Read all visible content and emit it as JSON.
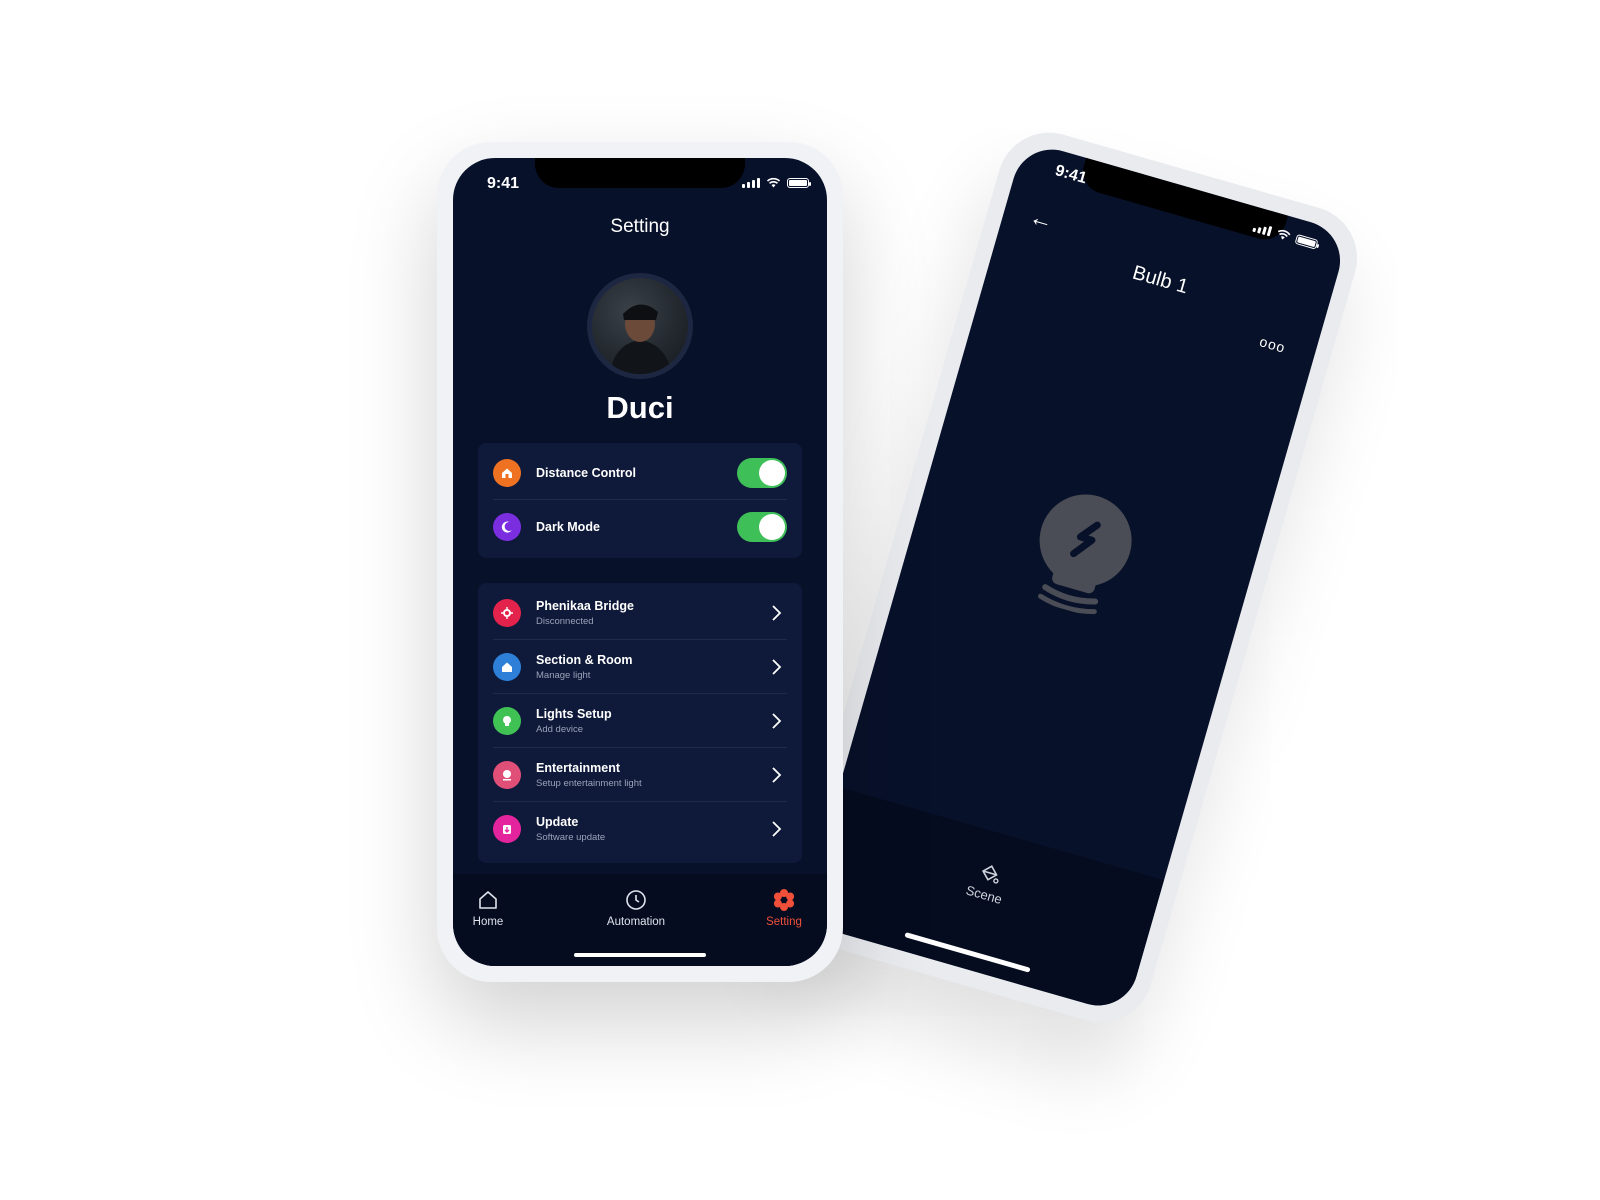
{
  "back_phone": {
    "time": "9:41",
    "title": "Bulb 1",
    "back_icon": "arrow-left-icon",
    "more_icon": "more-dots-icon",
    "bulb_icon": "bulb-icon",
    "tab": {
      "label": "Scene",
      "icon": "paint-bucket-icon"
    }
  },
  "front_phone": {
    "time": "9:41",
    "page_title": "Setting",
    "profile": {
      "name": "Duci"
    },
    "toggles": [
      {
        "label": "Distance Control",
        "icon": "home-icon",
        "color": "#ee7221",
        "on": true
      },
      {
        "label": "Dark Mode",
        "icon": "moon-icon",
        "color": "#7b2ee0",
        "on": true
      }
    ],
    "menu": [
      {
        "label": "Phenikaa Bridge",
        "sub": "Disconnected",
        "icon": "bridge-icon",
        "color": "#e3234b"
      },
      {
        "label": "Section & Room",
        "sub": "Manage light",
        "icon": "house-icon",
        "color": "#2d7fd8"
      },
      {
        "label": "Lights Setup",
        "sub": "Add device",
        "icon": "bulb-icon",
        "color": "#3fc154"
      },
      {
        "label": "Entertainment",
        "sub": "Setup entertainment light",
        "icon": "person-icon",
        "color": "#e04f77"
      },
      {
        "label": "Update",
        "sub": "Software update",
        "icon": "update-icon",
        "color": "#e3249c"
      }
    ],
    "tabs": [
      {
        "label": "Home",
        "icon": "home-icon",
        "active": false
      },
      {
        "label": "Automation",
        "icon": "clock-icon",
        "active": false
      },
      {
        "label": "Setting",
        "icon": "gear-icon",
        "active": true
      }
    ],
    "accent_color": "#f0503a"
  }
}
